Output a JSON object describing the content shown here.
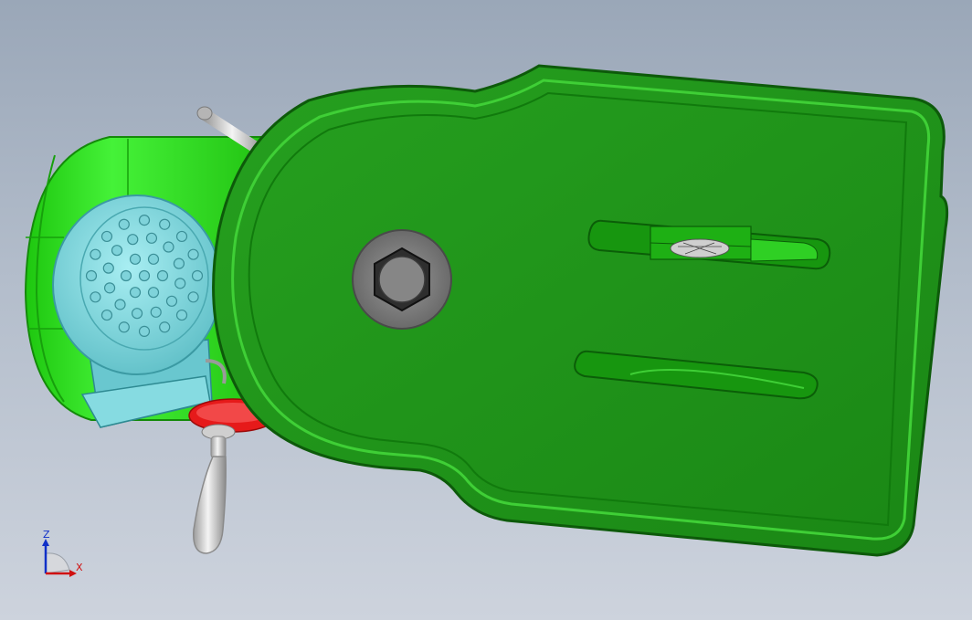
{
  "colors": {
    "background_top": "#9aa7b8",
    "background_bottom": "#cdd3dd",
    "guard_green": "#1f8f1a",
    "guard_green_light": "#33b82c",
    "guard_edge": "#0f5f0c",
    "motor_green": "#2ee51f",
    "fan_cover_cyan": "#7fd9df",
    "handwheel_red": "#e01818",
    "handle_silver": "#d8d8d8",
    "nut_gray": "#7d7d7d",
    "axis_x": "#d01010",
    "axis_z": "#1030c8"
  },
  "icons": {
    "hex_nut": "hex-nut-icon",
    "fan_vent": "fan-vent-icon",
    "triad": "coordinate-triad-icon"
  },
  "triad": {
    "x_label": "X",
    "z_label": "Z"
  }
}
